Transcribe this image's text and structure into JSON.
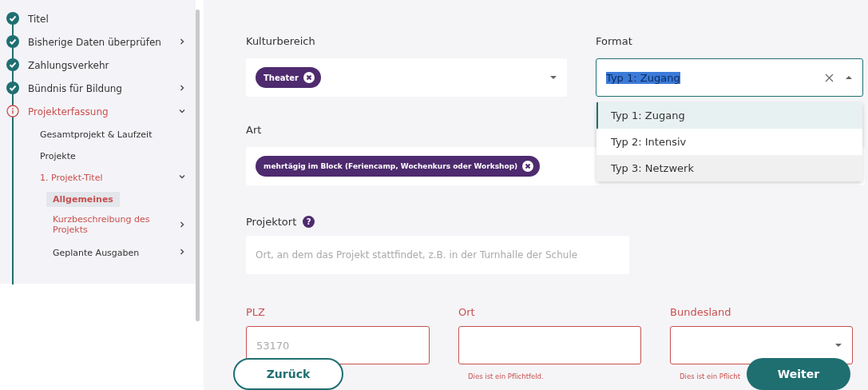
{
  "sidebar": {
    "items": [
      {
        "label": "Titel",
        "completed": true
      },
      {
        "label": "Bisherige Daten überprüfen",
        "completed": true,
        "expanded": false
      },
      {
        "label": "Zahlungsverkehr",
        "completed": true
      },
      {
        "label": "Bündnis für Bildung",
        "completed": true,
        "expanded": false
      },
      {
        "label": "Projekterfassung",
        "completed": false,
        "expanded": true,
        "children": [
          {
            "label": "Gesamtprojekt & Laufzeit",
            "error": false,
            "selected": false
          },
          {
            "label": "Projekte",
            "error": false,
            "selected": false
          },
          {
            "label": "1. Projekt-Titel",
            "error": true,
            "selected": false,
            "expanded": true,
            "children": [
              {
                "label": "Allgemeines",
                "error": true,
                "selected": true
              },
              {
                "label": "Kurzbeschreibung des Projekts",
                "error": true,
                "selected": false,
                "expanded": false
              },
              {
                "label": "Geplante Ausgaben",
                "error": false,
                "selected": false,
                "expanded": false
              }
            ]
          }
        ]
      }
    ]
  },
  "form": {
    "kulturbereich": {
      "label": "Kulturbereich",
      "chips": [
        "Theater"
      ]
    },
    "format": {
      "label": "Format",
      "value": "Typ 1: Zugang",
      "open": true,
      "options": [
        {
          "label": "Typ 1: Zugang",
          "selected": true,
          "hovered": false
        },
        {
          "label": "Typ 2: Intensiv",
          "selected": false,
          "hovered": false
        },
        {
          "label": "Typ 3: Netzwerk",
          "selected": false,
          "hovered": true
        }
      ]
    },
    "art": {
      "label": "Art",
      "chips": [
        "mehrtägig im Block (Feriencamp, Wochenkurs oder Workshop)"
      ]
    },
    "projektort": {
      "label": "Projektort",
      "help": "?",
      "placeholder": "Ort, an dem das Projekt stattfindet, z.B. in der Turnhalle der Schule"
    },
    "address": [
      {
        "label": "PLZ",
        "kind": "text",
        "placeholder": "53170",
        "invalid": true
      },
      {
        "label": "Ort",
        "kind": "text",
        "invalid": true,
        "error": "Dies ist ein Pflichtfeld."
      },
      {
        "label": "Bundesland",
        "kind": "select",
        "invalid": true,
        "error": "Dies ist ein Pflicht"
      }
    ]
  },
  "buttons": {
    "back": "Zurück",
    "next": "Weiter"
  }
}
